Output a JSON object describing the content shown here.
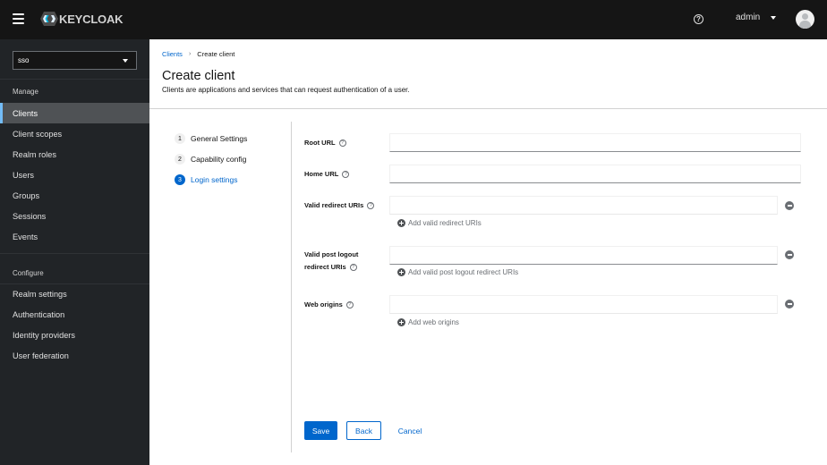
{
  "header": {
    "brand": "KEYCLOAK",
    "user": "admin",
    "help_icon": "?"
  },
  "sidebar": {
    "realm": "sso",
    "sections": [
      {
        "title": "Manage",
        "items": [
          {
            "label": "Clients",
            "active": true
          },
          {
            "label": "Client scopes"
          },
          {
            "label": "Realm roles"
          },
          {
            "label": "Users"
          },
          {
            "label": "Groups"
          },
          {
            "label": "Sessions"
          },
          {
            "label": "Events"
          }
        ]
      },
      {
        "title": "Configure",
        "items": [
          {
            "label": "Realm settings"
          },
          {
            "label": "Authentication"
          },
          {
            "label": "Identity providers"
          },
          {
            "label": "User federation"
          }
        ]
      }
    ]
  },
  "breadcrumb": {
    "parent": "Clients",
    "separator": "›",
    "current": "Create client"
  },
  "page": {
    "title": "Create client",
    "description": "Clients are applications and services that can request authentication of a user."
  },
  "wizard": {
    "steps": [
      {
        "num": "1",
        "label": "General Settings"
      },
      {
        "num": "2",
        "label": "Capability config"
      },
      {
        "num": "3",
        "label": "Login settings",
        "current": true
      }
    ]
  },
  "form": {
    "help": "?",
    "root_url": {
      "label": "Root URL",
      "value": ""
    },
    "home_url": {
      "label": "Home URL",
      "value": ""
    },
    "redirect_uris": {
      "label": "Valid redirect URIs",
      "value": "",
      "add": "Add valid redirect URIs"
    },
    "post_logout": {
      "label_line1": "Valid post logout",
      "label_line2": "redirect URIs",
      "value": "",
      "add": "Add valid post logout redirect URIs"
    },
    "web_origins": {
      "label": "Web origins",
      "value": "",
      "add": "Add web origins"
    }
  },
  "actions": {
    "save": "Save",
    "back": "Back",
    "cancel": "Cancel"
  },
  "colors": {
    "accent": "#0066cc",
    "masthead": "#151515",
    "sidebar": "#212427",
    "active_indicator": "#73bcf7"
  }
}
